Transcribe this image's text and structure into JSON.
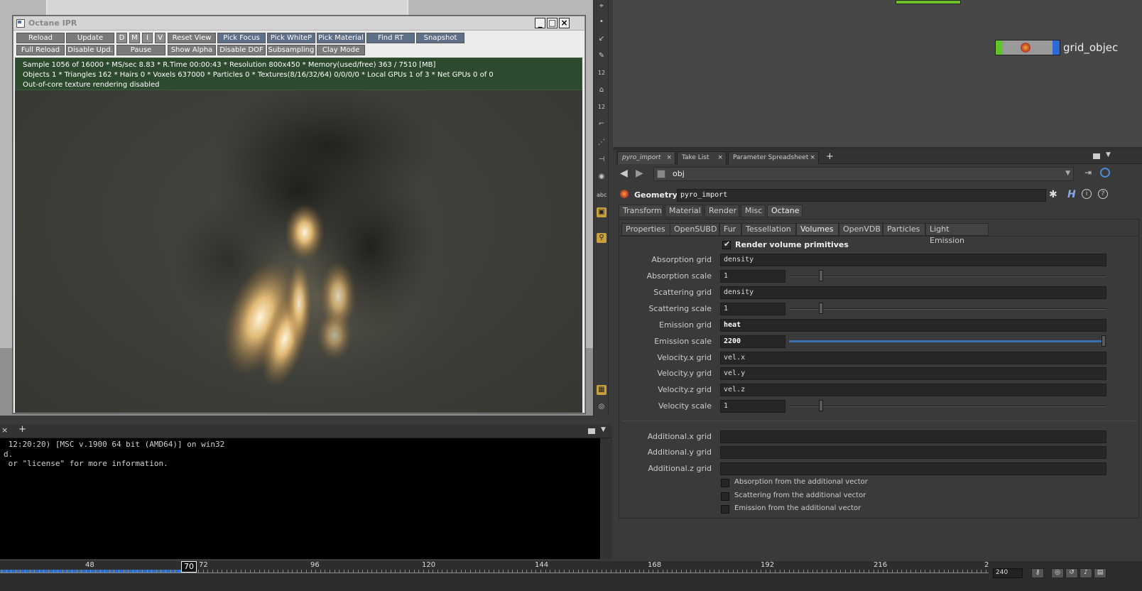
{
  "octane": {
    "title": "Octane IPR",
    "buttons_row1": [
      "Reload",
      "Update",
      "D",
      "M",
      "I",
      "V",
      "Reset View",
      "Pick Focus",
      "Pick WhiteP",
      "Pick Material",
      "Find RT",
      "Snapshot"
    ],
    "buttons_row2": [
      "Full Reload",
      "Disable Upd.",
      "Pause",
      "Show Alpha",
      "Disable DOF",
      "Subsampling",
      "Clay Mode"
    ],
    "status_line1": "Sample 1056 of 16000 * MS/sec 8.83 * R.Time 00:00:43 * Resolution 800x450 * Memory(used/free) 363 / 7510 [MB]",
    "status_line2": "Objects 1 * Triangles 162 * Hairs 0 * Voxels 637000 * Particles 0 * Textures(8/16/32/64) 0/0/0/0 * Local GPUs 1 of 3 * Net GPUs 0 of 0",
    "status_line3": "Out-of-core texture rendering disabled"
  },
  "network": {
    "node_label": "grid_objec"
  },
  "vtool": {
    "label_12a": "12",
    "label_12b": "12",
    "label_abc": "abc"
  },
  "tabs": {
    "items": [
      "pyro_import",
      "Take List",
      "Parameter Spreadsheet"
    ],
    "add": "+"
  },
  "path": {
    "value": "obj"
  },
  "geometry": {
    "type_label": "Geometry",
    "name": "pyro_import"
  },
  "tabs_l1": [
    "Transform",
    "Material",
    "Render",
    "Misc",
    "Octane"
  ],
  "tabs_l2": [
    "Properties",
    "OpenSUBD",
    "Fur",
    "Tessellation",
    "Volumes",
    "OpenVDB",
    "Particles",
    "Light Emission"
  ],
  "params": {
    "render_volume_label": "Render volume primitives",
    "absorption_grid": {
      "label": "Absorption grid",
      "value": "density"
    },
    "absorption_scale": {
      "label": "Absorption scale",
      "value": "1",
      "level": 0.1
    },
    "scattering_grid": {
      "label": "Scattering grid",
      "value": "density"
    },
    "scattering_scale": {
      "label": "Scattering scale",
      "value": "1",
      "level": 0.1
    },
    "emission_grid": {
      "label": "Emission grid",
      "value": "heat"
    },
    "emission_scale": {
      "label": "Emission scale",
      "value": "2200",
      "level": 1.0
    },
    "velx_grid": {
      "label": "Velocity.x grid",
      "value": "vel.x"
    },
    "vely_grid": {
      "label": "Velocity.y grid",
      "value": "vel.y"
    },
    "velz_grid": {
      "label": "Velocity.z grid",
      "value": "vel.z"
    },
    "velocity_scale": {
      "label": "Velocity scale",
      "value": "1",
      "level": 0.1
    },
    "addx_grid": {
      "label": "Additional.x grid",
      "value": ""
    },
    "addy_grid": {
      "label": "Additional.y grid",
      "value": ""
    },
    "addz_grid": {
      "label": "Additional.z grid",
      "value": ""
    },
    "cb_absorption": "Absorption from the additional vector",
    "cb_scattering": "Scattering from the additional vector",
    "cb_emission": "Emission from the additional vector"
  },
  "console": {
    "line1": " 12:20:20) [MSC v.1900 64 bit (AMD64)] on win32",
    "line2": "d.",
    "line3": " or \"license\" for more information."
  },
  "timeline": {
    "current_frame": "70",
    "labels": [
      "48",
      "72",
      "96",
      "120",
      "144",
      "168",
      "192",
      "216",
      "2"
    ],
    "end_frame": "240"
  }
}
